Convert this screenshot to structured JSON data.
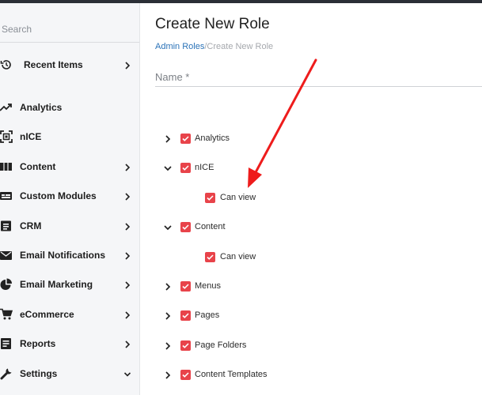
{
  "sidebar": {
    "search_placeholder": "Search",
    "items": [
      {
        "label": "Recent Items",
        "icon": "history-icon",
        "has_chevron": true,
        "chevron": "right"
      },
      {
        "label": "Analytics",
        "icon": "trending-up-icon",
        "has_chevron": false
      },
      {
        "label": "nICE",
        "icon": "scan-icon",
        "has_chevron": false
      },
      {
        "label": "Content",
        "icon": "table-icon",
        "has_chevron": true,
        "chevron": "right"
      },
      {
        "label": "Custom Modules",
        "icon": "module-icon",
        "has_chevron": true,
        "chevron": "right"
      },
      {
        "label": "CRM",
        "icon": "contact-card-icon",
        "has_chevron": true,
        "chevron": "right"
      },
      {
        "label": "Email Notifications",
        "icon": "mail-icon",
        "has_chevron": true,
        "chevron": "right"
      },
      {
        "label": "Email Marketing",
        "icon": "pie-chart-icon",
        "has_chevron": true,
        "chevron": "right"
      },
      {
        "label": "eCommerce",
        "icon": "cart-icon",
        "has_chevron": true,
        "chevron": "right"
      },
      {
        "label": "Reports",
        "icon": "report-icon",
        "has_chevron": true,
        "chevron": "right"
      },
      {
        "label": "Settings",
        "icon": "wrench-icon",
        "has_chevron": true,
        "chevron": "down"
      }
    ]
  },
  "main": {
    "title": "Create New Role",
    "breadcrumb": {
      "link": "Admin Roles",
      "current": "/Create New Role"
    },
    "name_label": "Name *"
  },
  "tree": [
    {
      "label": "Analytics",
      "expanded": false,
      "checked": true
    },
    {
      "label": "nICE",
      "expanded": true,
      "checked": true
    },
    {
      "label": "Can view",
      "leaf": true,
      "checked": true
    },
    {
      "label": "Content",
      "expanded": true,
      "checked": true
    },
    {
      "label": "Can view",
      "leaf": true,
      "checked": true
    },
    {
      "label": "Menus",
      "expanded": false,
      "checked": true
    },
    {
      "label": "Pages",
      "expanded": false,
      "checked": true
    },
    {
      "label": "Page Folders",
      "expanded": false,
      "checked": true
    },
    {
      "label": "Content Templates",
      "expanded": false,
      "checked": true
    }
  ],
  "colors": {
    "accent_red": "#e8434a",
    "link_blue": "#2b73b8",
    "annotation_arrow": "#ee1c1c"
  }
}
